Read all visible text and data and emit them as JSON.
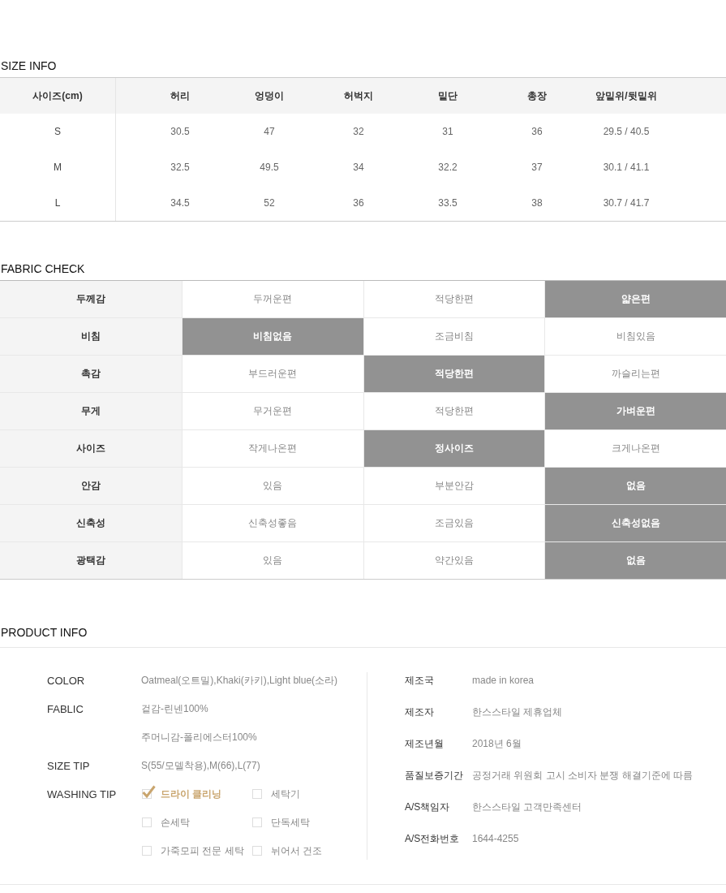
{
  "size_info": {
    "title": "SIZE INFO",
    "columns": [
      "사이즈(cm)",
      "허리",
      "엉덩이",
      "허벅지",
      "밑단",
      "총장",
      "앞밑위/뒷밑위"
    ],
    "rows": [
      [
        "S",
        "30.5",
        "47",
        "32",
        "31",
        "36",
        "29.5 / 40.5"
      ],
      [
        "M",
        "32.5",
        "49.5",
        "34",
        "32.2",
        "37",
        "30.1 / 41.1"
      ],
      [
        "L",
        "34.5",
        "52",
        "36",
        "33.5",
        "38",
        "30.7 / 41.7"
      ]
    ]
  },
  "fabric_check": {
    "title": "FABRIC CHECK",
    "rows": [
      {
        "label": "두께감",
        "options": [
          {
            "label": "두꺼운편",
            "selected": false
          },
          {
            "label": "적당한편",
            "selected": false
          },
          {
            "label": "얇은편",
            "selected": true
          }
        ]
      },
      {
        "label": "비침",
        "options": [
          {
            "label": "비침없음",
            "selected": true
          },
          {
            "label": "조금비침",
            "selected": false
          },
          {
            "label": "비침있음",
            "selected": false
          }
        ]
      },
      {
        "label": "촉감",
        "options": [
          {
            "label": "부드러운편",
            "selected": false
          },
          {
            "label": "적당한편",
            "selected": true
          },
          {
            "label": "까슬리는편",
            "selected": false
          }
        ]
      },
      {
        "label": "무게",
        "options": [
          {
            "label": "무거운편",
            "selected": false
          },
          {
            "label": "적당한편",
            "selected": false
          },
          {
            "label": "가벼운편",
            "selected": true
          }
        ]
      },
      {
        "label": "사이즈",
        "options": [
          {
            "label": "작게나온편",
            "selected": false
          },
          {
            "label": "정사이즈",
            "selected": true
          },
          {
            "label": "크게나온편",
            "selected": false
          }
        ]
      },
      {
        "label": "안감",
        "options": [
          {
            "label": "있음",
            "selected": false
          },
          {
            "label": "부분안감",
            "selected": false
          },
          {
            "label": "없음",
            "selected": true
          }
        ]
      },
      {
        "label": "신축성",
        "options": [
          {
            "label": "신축성좋음",
            "selected": false
          },
          {
            "label": "조금있음",
            "selected": false
          },
          {
            "label": "신축성없음",
            "selected": true
          }
        ]
      },
      {
        "label": "광택감",
        "options": [
          {
            "label": "있음",
            "selected": false
          },
          {
            "label": "약간있음",
            "selected": false
          },
          {
            "label": "없음",
            "selected": true
          }
        ]
      }
    ]
  },
  "product_info": {
    "title": "PRODUCT INFO",
    "left": [
      {
        "label": "COLOR",
        "values": [
          "Oatmeal(오트밀),Khaki(카키),Light blue(소라)"
        ]
      },
      {
        "label": "FABLIC",
        "values": [
          "겉감-린넨100%",
          "주머니감-폴리에스터100%"
        ]
      },
      {
        "label": "SIZE TIP",
        "values": [
          "S(55/모델착용),M(66),L(77)"
        ]
      }
    ],
    "washing_tip": {
      "label": "WASHING TIP",
      "options": [
        {
          "label": "드라이 클리닝",
          "checked": true
        },
        {
          "label": "세탁기",
          "checked": false
        },
        {
          "label": "손세탁",
          "checked": false
        },
        {
          "label": "단독세탁",
          "checked": false
        },
        {
          "label": "가죽모피 전문 세탁",
          "checked": false
        },
        {
          "label": "뉘어서 건조",
          "checked": false
        }
      ]
    },
    "right": [
      {
        "label": "제조국",
        "value": "made in korea"
      },
      {
        "label": "제조자",
        "value": "한스스타일 제휴업체"
      },
      {
        "label": "제조년월",
        "value": "2018년 6월"
      },
      {
        "label": "품질보증기간",
        "value": "공정거래 위원회 고시 소비자 분쟁 해결기준에 따름"
      },
      {
        "label": "A/S책임자",
        "value": "한스스타일 고객만족센터"
      },
      {
        "label": "A/S전화번호",
        "value": "1644-4255"
      }
    ]
  }
}
